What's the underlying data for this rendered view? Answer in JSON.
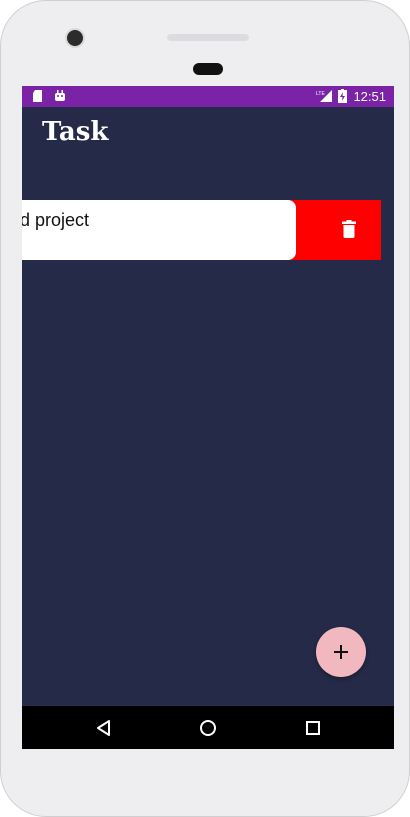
{
  "status_bar": {
    "time": "12:51",
    "network": "LTE",
    "left_icons": [
      "sd-card-icon",
      "android-icon"
    ],
    "right_icons": [
      "lte-signal-icon",
      "battery-charging-icon"
    ]
  },
  "app": {
    "title": "Task"
  },
  "tasks": [
    {
      "text": "d project",
      "swipe_action": "delete",
      "swipe_icon": "trash-icon"
    }
  ],
  "fab": {
    "icon": "plus-icon"
  },
  "nav_bar": {
    "buttons": [
      "back-icon",
      "home-icon",
      "recents-icon"
    ]
  },
  "colors": {
    "status_bar": "#7b23a7",
    "background": "#252a48",
    "delete": "#ff0000",
    "fab": "#f2b8c0"
  }
}
